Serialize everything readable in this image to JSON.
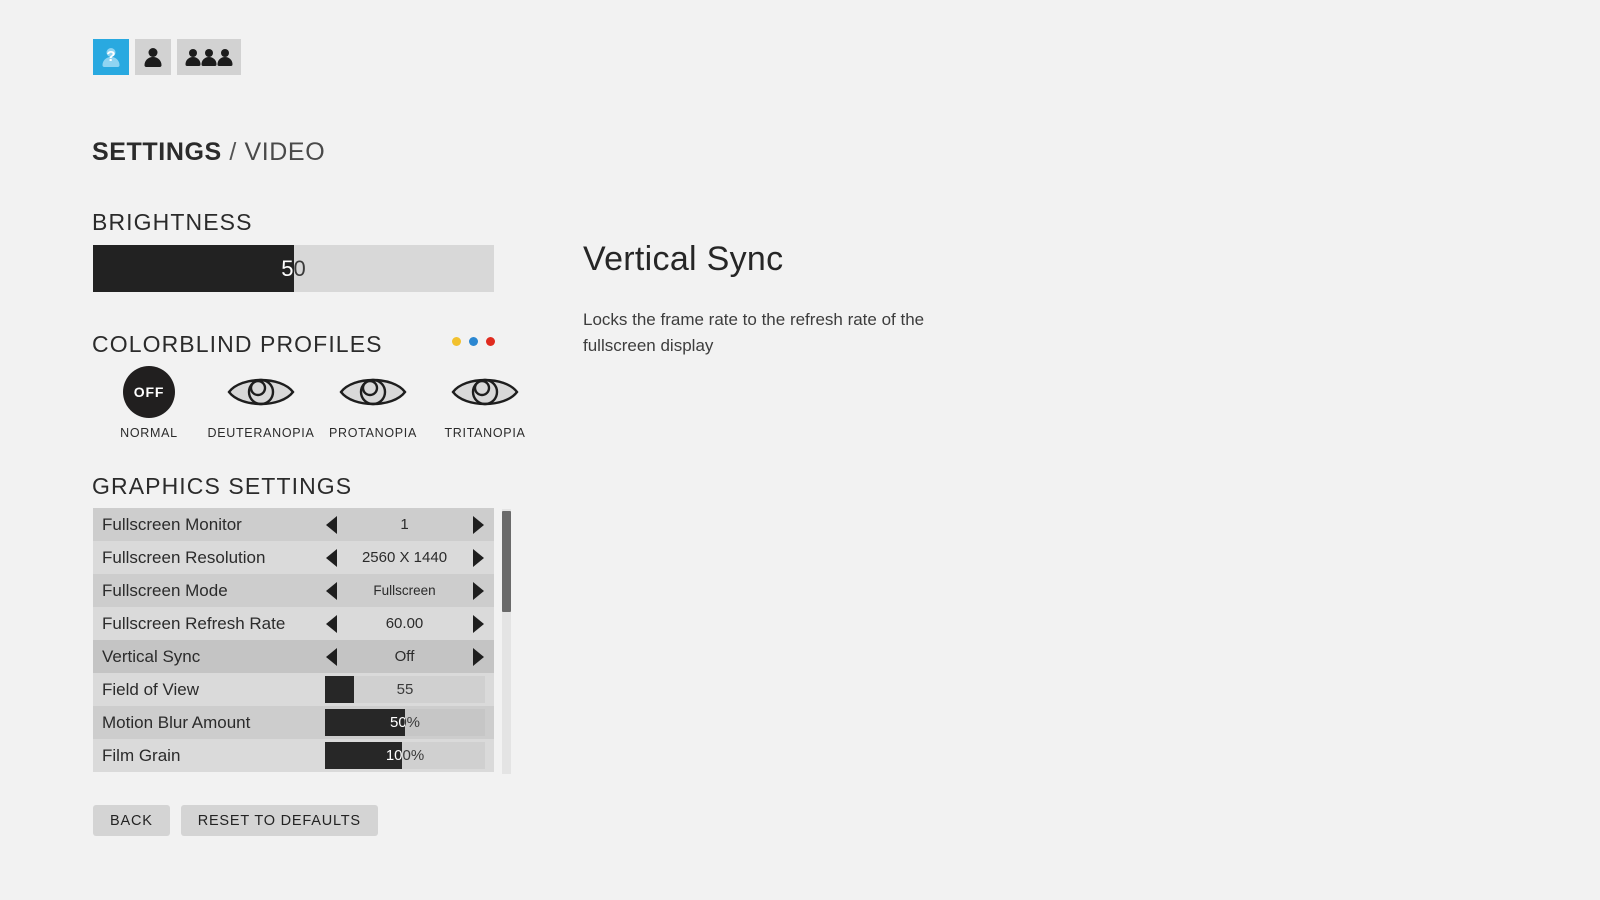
{
  "player_bar": {
    "slots": [
      {
        "name": "player-slot-unknown",
        "icon": "person-question-icon",
        "active": true
      },
      {
        "name": "player-slot-single",
        "icon": "person-icon",
        "active": false
      }
    ],
    "group": {
      "name": "player-group-three",
      "icon": "three-people-icon",
      "count": 3
    },
    "active_color": "#29a9e0",
    "slot_color": "#d2d2d2"
  },
  "breadcrumb": {
    "root": "SETTINGS",
    "separator": " / ",
    "current": "VIDEO"
  },
  "brightness": {
    "heading": "BRIGHTNESS",
    "value": 50,
    "value_label": "50",
    "fill_percent": 50,
    "fill_color": "#222222",
    "track_color": "#d8d8d8"
  },
  "colorblind": {
    "heading": "COLORBLIND PROFILES",
    "dots": [
      {
        "name": "dot-yellow",
        "color": "#f2c12e"
      },
      {
        "name": "dot-blue",
        "color": "#2b87d1"
      },
      {
        "name": "dot-red",
        "color": "#e02b1f"
      }
    ],
    "profiles": [
      {
        "label": "NORMAL",
        "icon": "off-circle-icon",
        "badge": "OFF",
        "selected": true
      },
      {
        "label": "DEUTERANOPIA",
        "icon": "eye-icon",
        "selected": false
      },
      {
        "label": "PROTANOPIA",
        "icon": "eye-icon",
        "selected": false
      },
      {
        "label": "TRITANOPIA",
        "icon": "eye-icon",
        "selected": false
      }
    ]
  },
  "graphics": {
    "heading": "GRAPHICS SETTINGS",
    "rows": [
      {
        "label": "Fullscreen Monitor",
        "type": "stepper",
        "value": "1",
        "small": false,
        "selected": false
      },
      {
        "label": "Fullscreen Resolution",
        "type": "stepper",
        "value": "2560 X 1440",
        "small": false,
        "selected": false
      },
      {
        "label": "Fullscreen Mode",
        "type": "stepper",
        "value": "Fullscreen",
        "small": true,
        "selected": false
      },
      {
        "label": "Fullscreen Refresh Rate",
        "type": "stepper",
        "value": "60.00",
        "small": false,
        "selected": false
      },
      {
        "label": "Vertical Sync",
        "type": "stepper",
        "value": "Off",
        "small": false,
        "selected": true
      },
      {
        "label": "Field of View",
        "type": "slider",
        "value": "55",
        "fill_percent": 18,
        "selected": false
      },
      {
        "label": "Motion Blur Amount",
        "type": "slider",
        "value": "50%",
        "fill_percent": 50,
        "selected": false
      },
      {
        "label": "Film Grain",
        "type": "slider",
        "value": "100%",
        "fill_percent": 48,
        "selected": false
      }
    ],
    "scrollbar": {
      "thumb_position_percent": 1,
      "thumb_size_percent": 38
    }
  },
  "buttons": {
    "back": "BACK",
    "reset": "RESET TO DEFAULTS"
  },
  "detail": {
    "title": "Vertical Sync",
    "description": "Locks the frame rate to the refresh rate of the fullscreen display"
  }
}
